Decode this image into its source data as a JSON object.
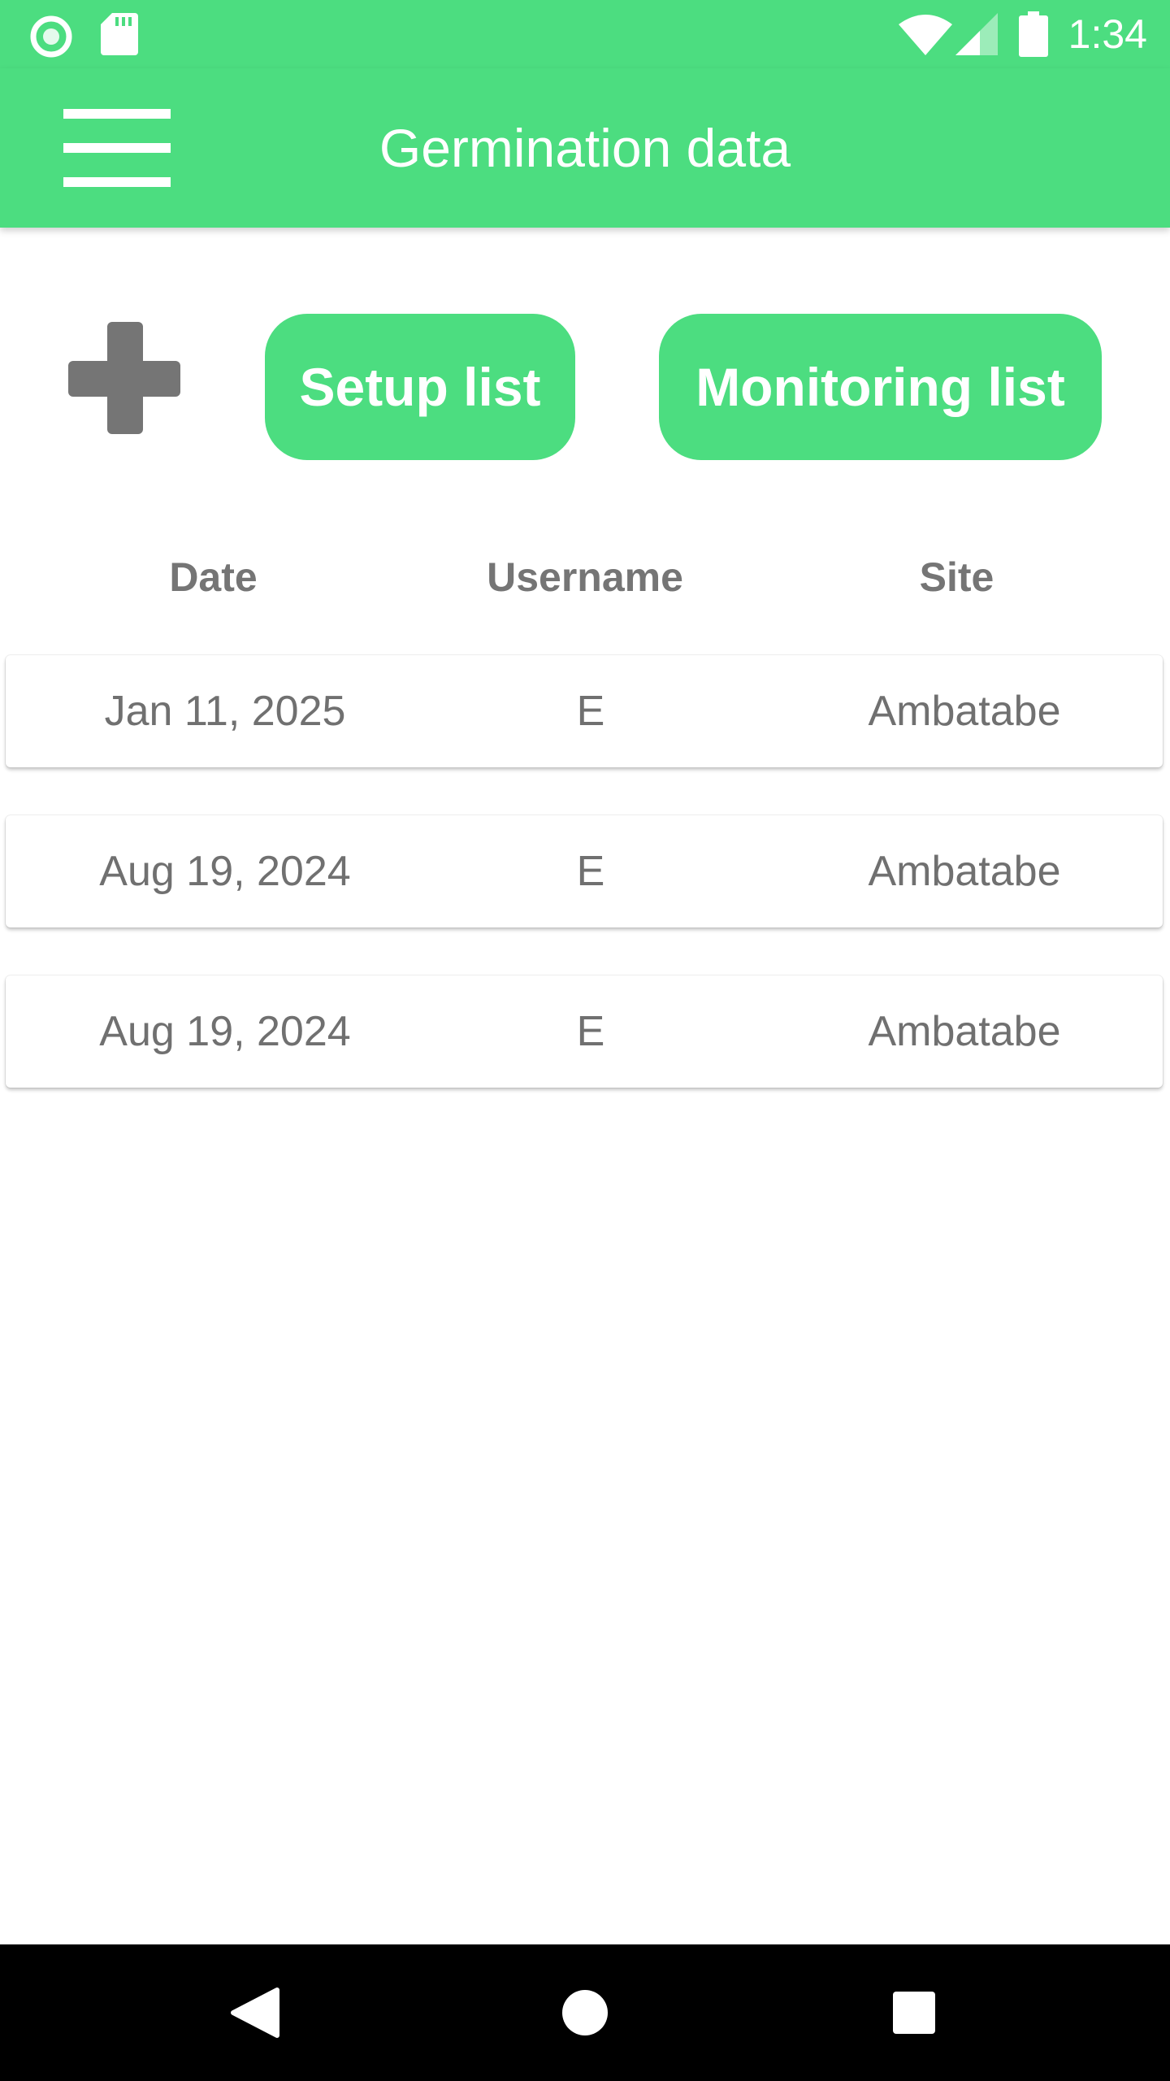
{
  "status_bar": {
    "time": "1:34",
    "left_icons": [
      "circle-notification-icon",
      "sd-card-icon"
    ],
    "right_icons": [
      "wifi-icon",
      "cell-signal-icon",
      "battery-icon"
    ]
  },
  "app_bar": {
    "title": "Germination data",
    "menu_icon": "hamburger-menu-icon"
  },
  "toolbar": {
    "add_icon": "plus-icon",
    "setup_label": "Setup list",
    "monitoring_label": "Monitoring list"
  },
  "table": {
    "headers": [
      "Date",
      "Username",
      "Site"
    ],
    "rows": [
      {
        "date": "Jan 11, 2025",
        "username": "E",
        "site": "Ambatabe"
      },
      {
        "date": "Aug 19, 2024",
        "username": "E",
        "site": "Ambatabe"
      },
      {
        "date": "Aug 19, 2024",
        "username": "E",
        "site": "Ambatabe"
      }
    ]
  },
  "nav_bar": {
    "icons": [
      "back-triangle-icon",
      "home-circle-icon",
      "recents-square-icon"
    ]
  },
  "colors": {
    "accent": "#4cdd80",
    "text_gray": "#757575",
    "nav_bar": "#000000"
  }
}
